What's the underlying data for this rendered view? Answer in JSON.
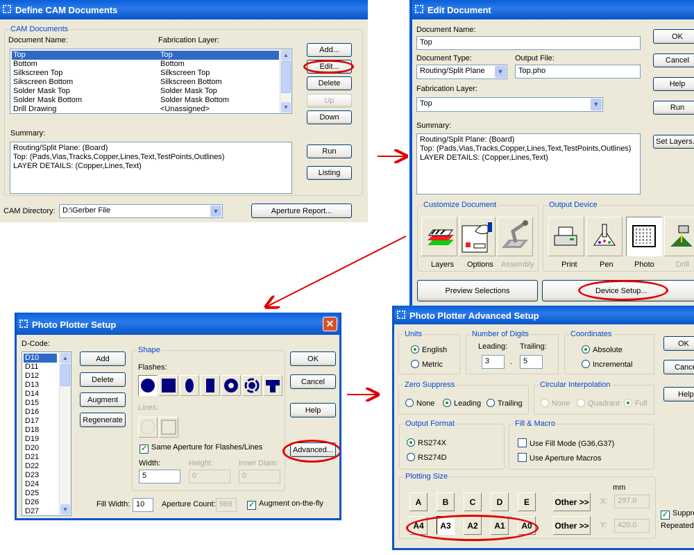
{
  "cam": {
    "title": "Define CAM Documents",
    "group": "CAM Documents",
    "col_name": "Document Name:",
    "col_layer": "Fabrication Layer:",
    "rows": [
      {
        "name": "Top",
        "layer": "Top"
      },
      {
        "name": "Bottom",
        "layer": "Bottom"
      },
      {
        "name": "Silkscreen Top",
        "layer": "Silkscreen Top"
      },
      {
        "name": "Sikscreen Bottom",
        "layer": "Silkscreen Bottom"
      },
      {
        "name": "Solder Mask Top",
        "layer": "Solder Mask Top"
      },
      {
        "name": "Solder Mask Bottom",
        "layer": "Solder Mask Bottom"
      },
      {
        "name": "Drill Drawing",
        "layer": "<Unassigned>"
      }
    ],
    "buttons": {
      "add": "Add...",
      "edit": "Edit...",
      "delete": "Delete",
      "up": "Up",
      "down": "Down",
      "run": "Run",
      "listing": "Listing",
      "aperture": "Aperture Report..."
    },
    "summary_label": "Summary:",
    "summary": [
      "Routing/Split Plane: (Board)",
      "Top: (Pads,Vias,Tracks,Copper,Lines,Text,TestPoints,Outlines)",
      "LAYER DETAILS: (Copper,Lines,Text)"
    ],
    "dir_label": "CAM Directory:",
    "dir_value": "D:\\Gerber File"
  },
  "edit": {
    "title": "Edit Document",
    "name_label": "Document Name:",
    "name_value": "Top",
    "type_label": "Document Type:",
    "type_value": "Routing/Split Plane",
    "output_label": "Output File:",
    "output_value": "Top.pho",
    "fab_label": "Fabrication Layer:",
    "fab_value": "Top",
    "summary_label": "Summary:",
    "summary": [
      "Routing/Split Plane: (Board)",
      "Top: (Pads,Vias,Tracks,Copper,Lines,Text,TestPoints,Outlines)",
      "LAYER DETAILS: (Copper,Lines,Text)"
    ],
    "buttons": {
      "ok": "OK",
      "cancel": "Cancel",
      "help": "Help",
      "run": "Run",
      "set_layers": "Set Layers...",
      "preview": "Preview Selections",
      "device_setup": "Device Setup..."
    },
    "customize_label": "Customize Document",
    "customize": [
      "Layers",
      "Options",
      "Assembly"
    ],
    "output_device_label": "Output Device",
    "devices": [
      "Print",
      "Pen",
      "Photo",
      "Drill"
    ]
  },
  "photo": {
    "title": "Photo Plotter Setup",
    "dcode_label": "D-Code:",
    "dcodes": [
      "D10",
      "D11",
      "D12",
      "D13",
      "D14",
      "D15",
      "D16",
      "D17",
      "D18",
      "D19",
      "D20",
      "D21",
      "D22",
      "D23",
      "D24",
      "D25",
      "D26",
      "D27"
    ],
    "buttons": {
      "add": "Add",
      "delete": "Delete",
      "augment": "Augment",
      "regenerate": "Regenerate",
      "ok": "OK",
      "cancel": "Cancel",
      "help": "Help",
      "advanced": "Advanced..."
    },
    "shape_label": "Shape",
    "flashes_label": "Flashes:",
    "lines_label": "Lines:",
    "same_aperture": "Same Aperture for Flashes/Lines",
    "width_label": "Width:",
    "width_value": "5",
    "height_label": "Height:",
    "height_value": "0",
    "inner_label": "Inner Diam:",
    "inner_value": "0",
    "fill_label": "Fill Width:",
    "fill_value": "10",
    "count_label": "Aperture Count:",
    "count_value": "989",
    "augment_fly": "Augment on-the-fly"
  },
  "adv": {
    "title": "Photo Plotter Advanced Setup",
    "units_label": "Units",
    "english": "English",
    "metric": "Metric",
    "digits_label": "Number of Digits",
    "leading_label": "Leading:",
    "leading_value": "3",
    "trailing_label": "Trailing:",
    "trailing_value": "5",
    "dot": ".",
    "coord_label": "Coordinates",
    "absolute": "Absolute",
    "incremental": "Incremental",
    "zero_label": "Zero Suppress",
    "zero_none": "None",
    "zero_leading": "Leading",
    "zero_trailing": "Trailing",
    "circ_label": "Circular Interpolation",
    "circ_none": "None",
    "circ_quadrant": "Quadrant",
    "circ_full": "Full",
    "format_label": "Output Format",
    "rs274x": "RS274X",
    "rs274d": "RS274D",
    "fill_label": "Fill & Macro",
    "fill_mode": "Use Fill Mode (G36,G37)",
    "macros": "Use Aperture Macros",
    "plot_label": "Plotting Size",
    "sizes_row1": [
      "A",
      "B",
      "C",
      "D",
      "E"
    ],
    "sizes_row2": [
      "A4",
      "A3",
      "A2",
      "A1",
      "A0"
    ],
    "other": "Other >>",
    "mm": "mm",
    "x_label": "X:",
    "x_value": "297.0",
    "y_label": "Y:",
    "y_value": "420.0",
    "ok": "OK",
    "cancel": "Cance",
    "help": "Help",
    "suppress": "Suppre",
    "repeated": "Repeated"
  },
  "colors": {
    "annotation": "#e00000",
    "selection": "#316ac5",
    "group_label": "#0046d5"
  }
}
